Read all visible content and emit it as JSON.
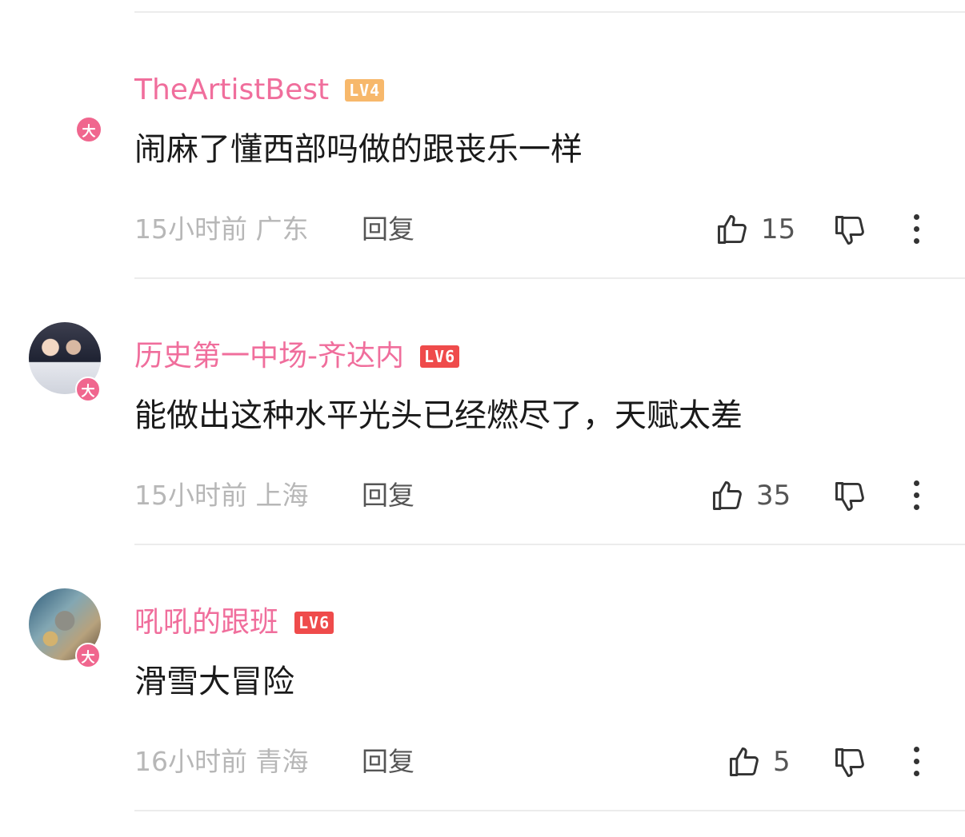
{
  "comments": [
    {
      "username": "TheArtistBest",
      "level": "LV4",
      "badge": "大",
      "text": "闹麻了懂西部吗做的跟丧乐一样",
      "time": "15小时前",
      "location": "广东",
      "reply_label": "回复",
      "likes": "15"
    },
    {
      "username": "历史第一中场-齐达内",
      "level": "LV6",
      "badge": "大",
      "text": "能做出这种水平光头已经燃尽了，天赋太差",
      "time": "15小时前",
      "location": "上海",
      "reply_label": "回复",
      "likes": "35"
    },
    {
      "username": "吼吼的跟班",
      "level": "LV6",
      "badge": "大",
      "text": "滑雪大冒险",
      "time": "16小时前",
      "location": "青海",
      "reply_label": "回复",
      "likes": "5"
    }
  ],
  "icons": {
    "like": "thumbs-up-icon",
    "dislike": "thumbs-down-icon",
    "more": "more-vertical-icon"
  },
  "colors": {
    "username": "#f06e9c",
    "lv4": "#f7b86b",
    "lv6": "#ef4b4b",
    "badge": "#f0668e"
  }
}
